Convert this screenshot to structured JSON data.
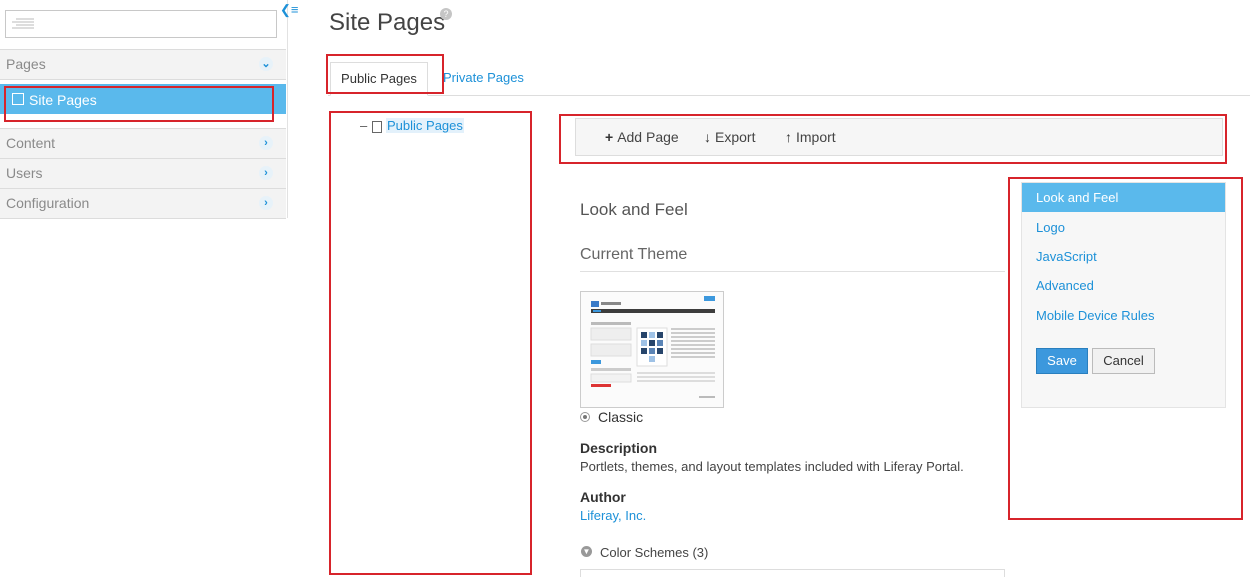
{
  "page": {
    "title": "Site Pages",
    "help_icon": "question-icon"
  },
  "sidebar": {
    "search_icon": "hamburger-icon",
    "sections": [
      {
        "label": "Pages"
      },
      {
        "label": "Site Pages"
      },
      {
        "label": "Content"
      },
      {
        "label": "Users"
      },
      {
        "label": "Configuration"
      }
    ]
  },
  "tabs": [
    {
      "label": "Public Pages"
    },
    {
      "label": "Private Pages"
    }
  ],
  "tree": {
    "root_label": "Public Pages"
  },
  "toolbar": {
    "add_label": "Add Page",
    "export_label": "Export",
    "import_label": "Import"
  },
  "content": {
    "heading": "Look and Feel",
    "subheading": "Current Theme",
    "theme_name": "Classic",
    "description_label": "Description",
    "description_text": "Portlets, themes, and layout templates included with Liferay Portal.",
    "author_label": "Author",
    "author_value": "Liferay, Inc.",
    "color_schemes": "Color Schemes (3)"
  },
  "right_nav": {
    "items": [
      {
        "label": "Look and Feel"
      },
      {
        "label": "Logo"
      },
      {
        "label": "JavaScript"
      },
      {
        "label": "Advanced"
      },
      {
        "label": "Mobile Device Rules"
      }
    ],
    "save_label": "Save",
    "cancel_label": "Cancel"
  },
  "colors": {
    "accent": "#1d91d8",
    "active_bg": "#5ab9ec",
    "highlight": "#d7242b"
  }
}
